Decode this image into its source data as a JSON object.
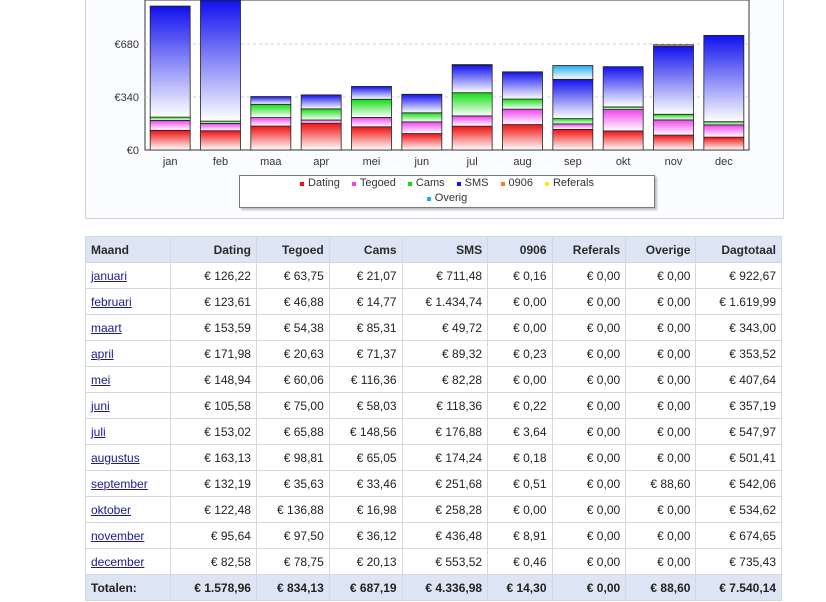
{
  "chart_data": {
    "type": "bar",
    "stacked": true,
    "categories": [
      "jan",
      "feb",
      "maa",
      "apr",
      "mei",
      "jun",
      "jul",
      "aug",
      "sep",
      "okt",
      "nov",
      "dec"
    ],
    "y_ticks": [
      "€0",
      "€340",
      "€680"
    ],
    "y_tick_values": [
      0,
      340,
      680
    ],
    "ylim": [
      0,
      960
    ],
    "series": [
      {
        "name": "Dating",
        "color": "#ee1111",
        "values": [
          126.22,
          123.61,
          153.59,
          171.98,
          148.94,
          105.58,
          153.02,
          163.13,
          132.19,
          122.48,
          95.64,
          82.58
        ]
      },
      {
        "name": "Tegoed",
        "color": "#ee44ee",
        "values": [
          63.75,
          46.88,
          54.38,
          20.63,
          60.06,
          75.0,
          65.88,
          98.81,
          35.63,
          136.88,
          97.5,
          78.75
        ]
      },
      {
        "name": "Cams",
        "color": "#11dd11",
        "values": [
          21.07,
          14.77,
          85.31,
          71.37,
          116.36,
          58.03,
          148.56,
          65.05,
          33.46,
          16.98,
          36.12,
          20.13
        ]
      },
      {
        "name": "SMS",
        "color": "#1111ee",
        "values": [
          711.48,
          1434.74,
          49.72,
          89.32,
          82.28,
          118.36,
          176.88,
          174.24,
          251.68,
          258.28,
          436.48,
          553.52
        ]
      },
      {
        "name": "0906",
        "color": "#ff7733",
        "values": [
          0.16,
          0.0,
          0.0,
          0.23,
          0.0,
          0.22,
          3.64,
          0.18,
          0.51,
          0.0,
          8.91,
          0.46
        ]
      },
      {
        "name": "Referals",
        "color": "#eeee11",
        "values": [
          0,
          0,
          0,
          0,
          0,
          0,
          0,
          0,
          0,
          0,
          0,
          0
        ]
      },
      {
        "name": "Overig",
        "color": "#22aaee",
        "values": [
          0,
          0,
          0,
          0,
          0,
          0,
          0,
          0,
          88.6,
          0,
          0,
          0
        ]
      }
    ],
    "legend_position": "bottom",
    "grid": true
  },
  "table": {
    "headers": [
      "Maand",
      "Dating",
      "Tegoed",
      "Cams",
      "SMS",
      "0906",
      "Referals",
      "Overige",
      "Dagtotaal"
    ],
    "rows": [
      [
        "januari",
        "€ 126,22",
        "€ 63,75",
        "€ 21,07",
        "€ 711,48",
        "€ 0,16",
        "€ 0,00",
        "€ 0,00",
        "€ 922,67"
      ],
      [
        "februari",
        "€ 123,61",
        "€ 46,88",
        "€ 14,77",
        "€ 1.434,74",
        "€ 0,00",
        "€ 0,00",
        "€ 0,00",
        "€ 1.619,99"
      ],
      [
        "maart",
        "€ 153,59",
        "€ 54,38",
        "€ 85,31",
        "€ 49,72",
        "€ 0,00",
        "€ 0,00",
        "€ 0,00",
        "€ 343,00"
      ],
      [
        "april",
        "€ 171,98",
        "€ 20,63",
        "€ 71,37",
        "€ 89,32",
        "€ 0,23",
        "€ 0,00",
        "€ 0,00",
        "€ 353,52"
      ],
      [
        "mei",
        "€ 148,94",
        "€ 60,06",
        "€ 116,36",
        "€ 82,28",
        "€ 0,00",
        "€ 0,00",
        "€ 0,00",
        "€ 407,64"
      ],
      [
        "juni",
        "€ 105,58",
        "€ 75,00",
        "€ 58,03",
        "€ 118,36",
        "€ 0,22",
        "€ 0,00",
        "€ 0,00",
        "€ 357,19"
      ],
      [
        "juli",
        "€ 153,02",
        "€ 65,88",
        "€ 148,56",
        "€ 176,88",
        "€ 3,64",
        "€ 0,00",
        "€ 0,00",
        "€ 547,97"
      ],
      [
        "augustus",
        "€ 163,13",
        "€ 98,81",
        "€ 65,05",
        "€ 174,24",
        "€ 0,18",
        "€ 0,00",
        "€ 0,00",
        "€ 501,41"
      ],
      [
        "september",
        "€ 132,19",
        "€ 35,63",
        "€ 33,46",
        "€ 251,68",
        "€ 0,51",
        "€ 0,00",
        "€ 88,60",
        "€ 542,06"
      ],
      [
        "oktober",
        "€ 122,48",
        "€ 136,88",
        "€ 16,98",
        "€ 258,28",
        "€ 0,00",
        "€ 0,00",
        "€ 0,00",
        "€ 534,62"
      ],
      [
        "november",
        "€ 95,64",
        "€ 97,50",
        "€ 36,12",
        "€ 436,48",
        "€ 8,91",
        "€ 0,00",
        "€ 0,00",
        "€ 674,65"
      ],
      [
        "december",
        "€ 82,58",
        "€ 78,75",
        "€ 20,13",
        "€ 553,52",
        "€ 0,46",
        "€ 0,00",
        "€ 0,00",
        "€ 735,43"
      ]
    ],
    "totals": [
      "Totalen:",
      "€ 1.578,96",
      "€ 834,13",
      "€ 687,19",
      "€ 4.336,98",
      "€ 14,30",
      "€ 0,00",
      "€ 88,60",
      "€ 7.540,14"
    ]
  }
}
